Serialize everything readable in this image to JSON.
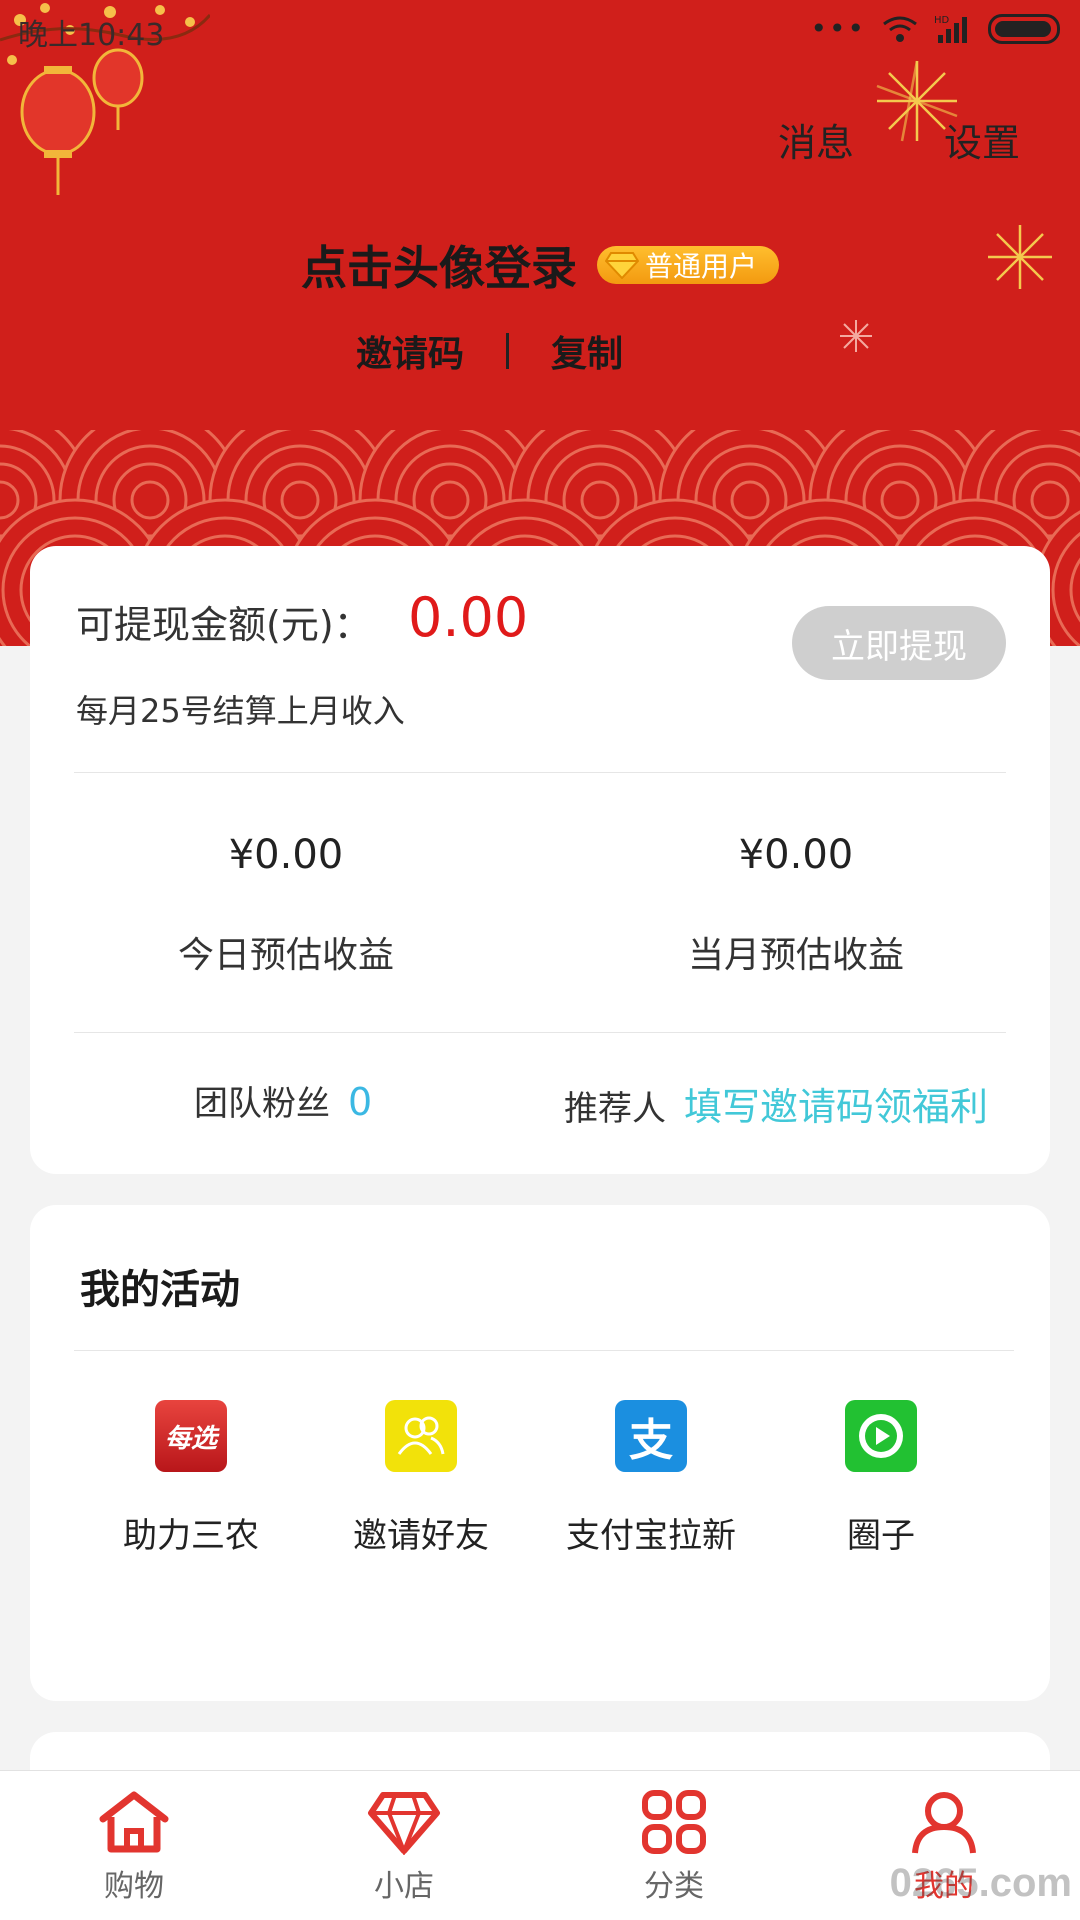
{
  "status_bar": {
    "time": "晚上10:43",
    "network": "HD"
  },
  "header": {
    "messages_label": "消息",
    "settings_label": "设置",
    "login_prompt": "点击头像登录",
    "badge_label": "普通用户",
    "invite_code_label": "邀请码",
    "copy_label": "复制"
  },
  "income": {
    "withdrawable_label": "可提现金额(元)：",
    "withdrawable_amount": "0.00",
    "withdraw_button": "立即提现",
    "settlement_note": "每月25号结算上月收入",
    "today_value": "¥0.00",
    "today_label": "今日预估收益",
    "month_value": "¥0.00",
    "month_label": "当月预估收益",
    "fans_label": "团队粉丝",
    "fans_count": "0",
    "referrer_label": "推荐人",
    "referrer_link": "填写邀请码领福利"
  },
  "activity": {
    "title": "我的活动",
    "items": [
      {
        "label": "助力三农",
        "icon_text": "每选",
        "icon": "meixuan-icon",
        "color": "#d42a2a"
      },
      {
        "label": "邀请好友",
        "icon": "friends-icon",
        "color": "#f2e20a"
      },
      {
        "label": "支付宝拉新",
        "icon_text": "支",
        "icon": "alipay-icon",
        "color": "#1b8fe0"
      },
      {
        "label": "圈子",
        "icon": "circle-play-icon",
        "color": "#22c132"
      }
    ]
  },
  "nav": {
    "items": [
      {
        "label": "购物",
        "icon": "home-icon"
      },
      {
        "label": "小店",
        "icon": "diamond-icon"
      },
      {
        "label": "分类",
        "icon": "grid-icon"
      },
      {
        "label": "我的",
        "icon": "user-icon",
        "active": true
      }
    ]
  },
  "watermark": "0265.com",
  "colors": {
    "header_red": "#d01f1b",
    "accent_red": "#e01a1a",
    "link_cyan": "#42c8d8",
    "fans_blue": "#3bb8e3"
  }
}
